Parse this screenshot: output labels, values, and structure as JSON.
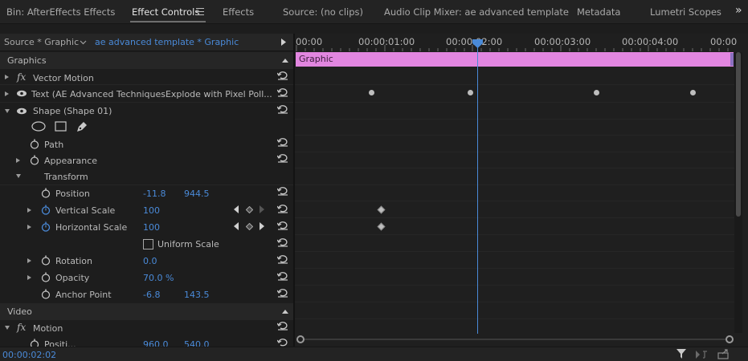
{
  "tabs": [
    {
      "label": "Bin: AfterEffects Effects",
      "active": false
    },
    {
      "label": "Effect Controls",
      "active": true
    },
    {
      "label": "Effects",
      "active": false
    },
    {
      "label": "Source: (no clips)",
      "active": false
    },
    {
      "label": "Audio Clip Mixer: ae advanced template",
      "active": false
    },
    {
      "label": "Metadata",
      "active": false
    },
    {
      "label": "Lumetri Scopes",
      "active": false
    }
  ],
  "overflow_icon": "double-chevron-right-icon",
  "source": {
    "label": "Source * Graphic",
    "sequence": "ae advanced template * Graphic"
  },
  "timecodes": [
    "00:00",
    "00:00:01:00",
    "00:00:02:00",
    "00:00:03:00",
    "00:00:04:00",
    "00:00"
  ],
  "clip_label": "Graphic",
  "sections": {
    "graphics": "Graphics",
    "video": "Video"
  },
  "rows": {
    "vector_motion": "Vector Motion",
    "text": "Text (AE Advanced TechniquesExplode with Pixel Poll...",
    "shape": "Shape (Shape 01)",
    "path": "Path",
    "appearance": "Appearance",
    "transform": "Transform",
    "position": {
      "label": "Position",
      "x": "-11.8",
      "y": "944.5"
    },
    "vertical_scale": {
      "label": "Vertical Scale",
      "value": "100"
    },
    "horizontal_scale": {
      "label": "Horizontal Scale",
      "value": "100"
    },
    "uniform_scale": "Uniform Scale",
    "rotation": {
      "label": "Rotation",
      "value": "0.0"
    },
    "opacity": {
      "label": "Opacity",
      "value": "70.0 %"
    },
    "anchor_point": {
      "label": "Anchor Point",
      "x": "-6.8",
      "y": "143.5"
    },
    "motion": "Motion",
    "motion_position": {
      "label": "Positi...",
      "x": "960.0",
      "y": "540.0"
    }
  },
  "current_time": "00:00:02:02",
  "colors": {
    "accent": "#4a8ad8",
    "clip": "#e286e0",
    "panel_bg": "#1d1d1d"
  }
}
